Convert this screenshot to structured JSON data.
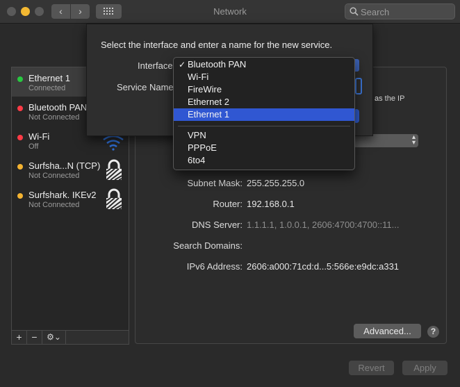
{
  "window": {
    "title": "Network"
  },
  "search": {
    "placeholder": "Search"
  },
  "sidebar": {
    "items": [
      {
        "name": "Ethernet 1",
        "status": "Connected",
        "color": "#28c840"
      },
      {
        "name": "Bluetooth PAN",
        "status": "Not Connected",
        "color": "#ff3b46"
      },
      {
        "name": "Wi-Fi",
        "status": "Off",
        "color": "#ff3b46"
      },
      {
        "name": "Surfsha...N (TCP)",
        "status": "Not Connected",
        "color": "#f4b331"
      },
      {
        "name": "Surfshark. IKEv2",
        "status": "Not Connected",
        "color": "#f4b331"
      }
    ],
    "footer": {
      "add": "+",
      "remove": "−",
      "gear": "⚙⌄"
    }
  },
  "dialog": {
    "prompt": "Select the interface and enter a name for the new service.",
    "interface_label": "Interface",
    "service_name_label": "Service Name",
    "side_text": "as the IP"
  },
  "menu": {
    "items": [
      "Bluetooth PAN",
      "Wi-Fi",
      "FireWire",
      "Ethernet 2",
      "Ethernet 1"
    ],
    "items2": [
      "VPN",
      "PPPoE",
      "6to4"
    ],
    "checked": "Bluetooth PAN",
    "highlighted": "Ethernet 1",
    "checkmark": "✓"
  },
  "details": {
    "subnet_label": "Subnet Mask:",
    "subnet": "255.255.255.0",
    "router_label": "Router:",
    "router": "192.168.0.1",
    "dns_label": "DNS Server:",
    "dns": "1.1.1.1, 1.0.0.1, 2606:4700:4700::11...",
    "search_domains_label": "Search Domains:",
    "ipv6_label": "IPv6 Address:",
    "ipv6": "2606:a000:71cd:d...5:566e:e9dc:a331"
  },
  "buttons": {
    "advanced": "Advanced...",
    "help": "?",
    "revert": "Revert",
    "apply": "Apply"
  },
  "colors": {
    "accent": "#3057d2",
    "connected": "#28c840",
    "disconnected": "#ff3b46",
    "vpn": "#f4b331"
  }
}
